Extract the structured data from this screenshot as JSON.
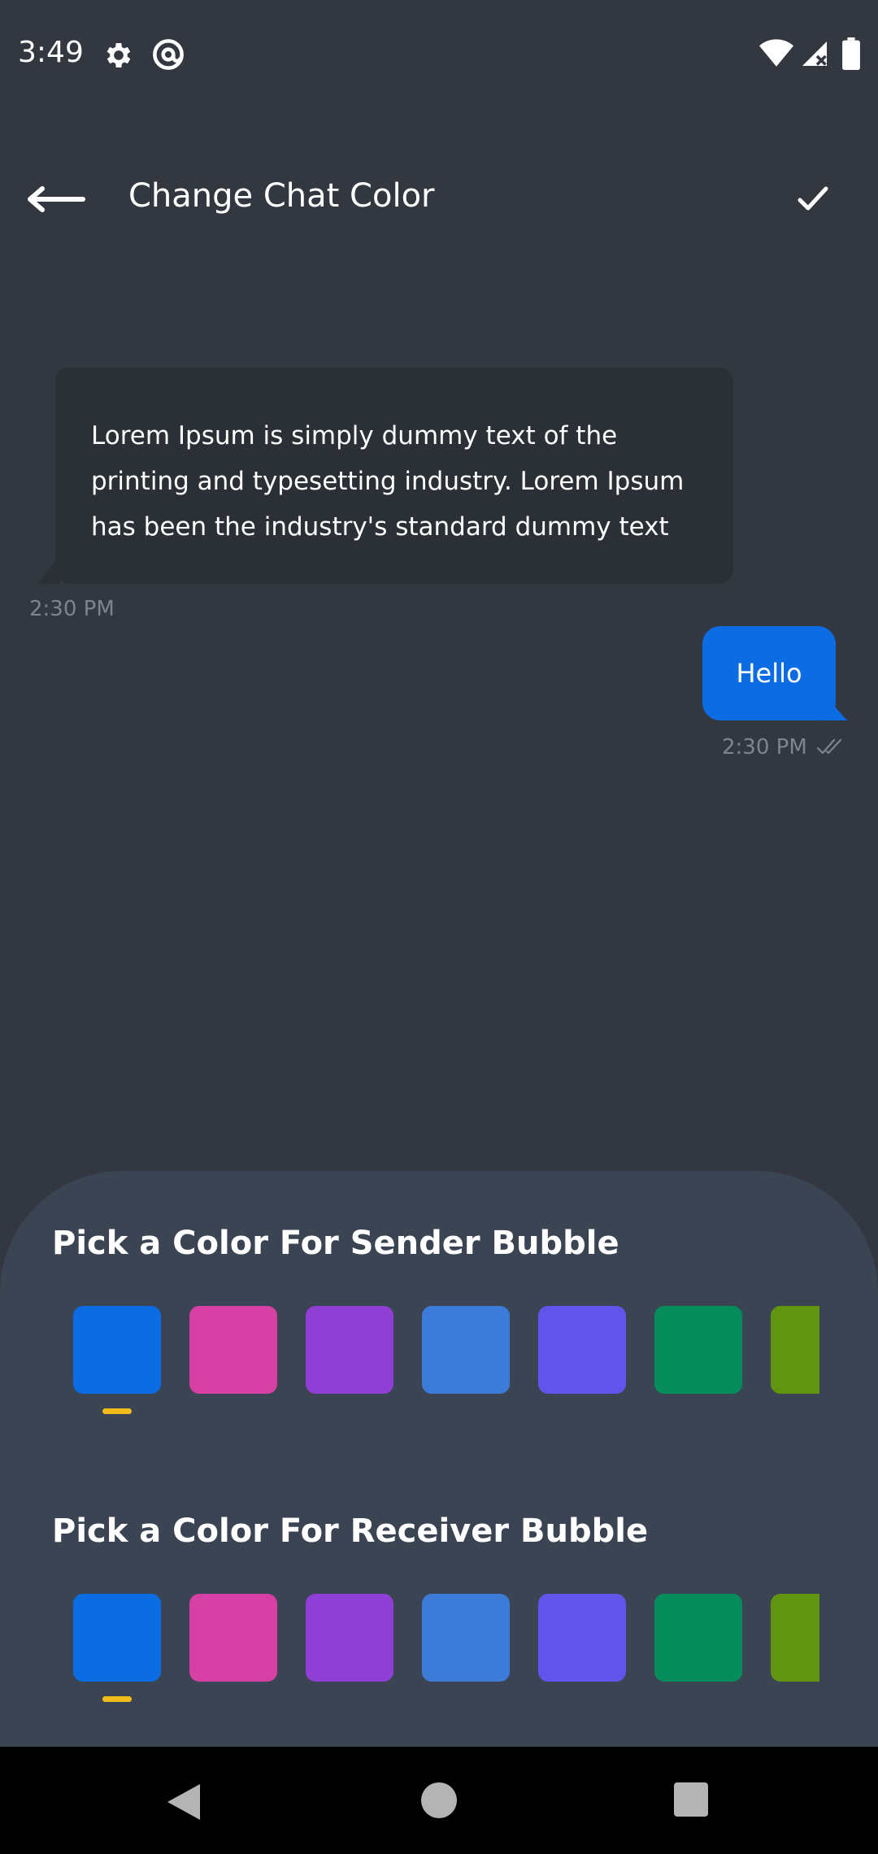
{
  "status_bar": {
    "time": "3:49",
    "icons": [
      "gear-icon",
      "at-sign-icon",
      "wifi-icon",
      "cell-signal-icon",
      "battery-icon"
    ]
  },
  "app_bar": {
    "title": "Change Chat Color",
    "back_icon": "arrow-left-icon",
    "confirm_icon": "checkmark-icon"
  },
  "chat_preview": {
    "incoming": {
      "text": "Lorem Ipsum is simply dummy text of the printing and typesetting industry. Lorem Ipsum has been the industry's standard dummy text ever since the",
      "time": "2:30 PM",
      "bubble_color": "#2b2f36"
    },
    "outgoing": {
      "text": "Hello",
      "time": "2:30 PM",
      "status_icon": "double-check-icon",
      "bubble_color": "#0b6ce3"
    }
  },
  "color_picker": {
    "sender": {
      "title": "Pick a Color For Sender Bubble",
      "selected_index": 0
    },
    "receiver": {
      "title": "Pick a Color For Receiver Bubble",
      "selected_index": 0
    },
    "swatches": [
      "#0b6ce3",
      "#d63fa3",
      "#8f3fd6",
      "#3d7bd9",
      "#6054ea",
      "#058e5c",
      "#62950f"
    ],
    "selected_indicator_color": "#f2bd1b"
  },
  "theme": {
    "background": "#333840",
    "sheet_background": "#3b4452"
  },
  "nav_bar": {
    "icons": [
      "nav-back-icon",
      "nav-home-icon",
      "nav-recents-icon"
    ]
  }
}
